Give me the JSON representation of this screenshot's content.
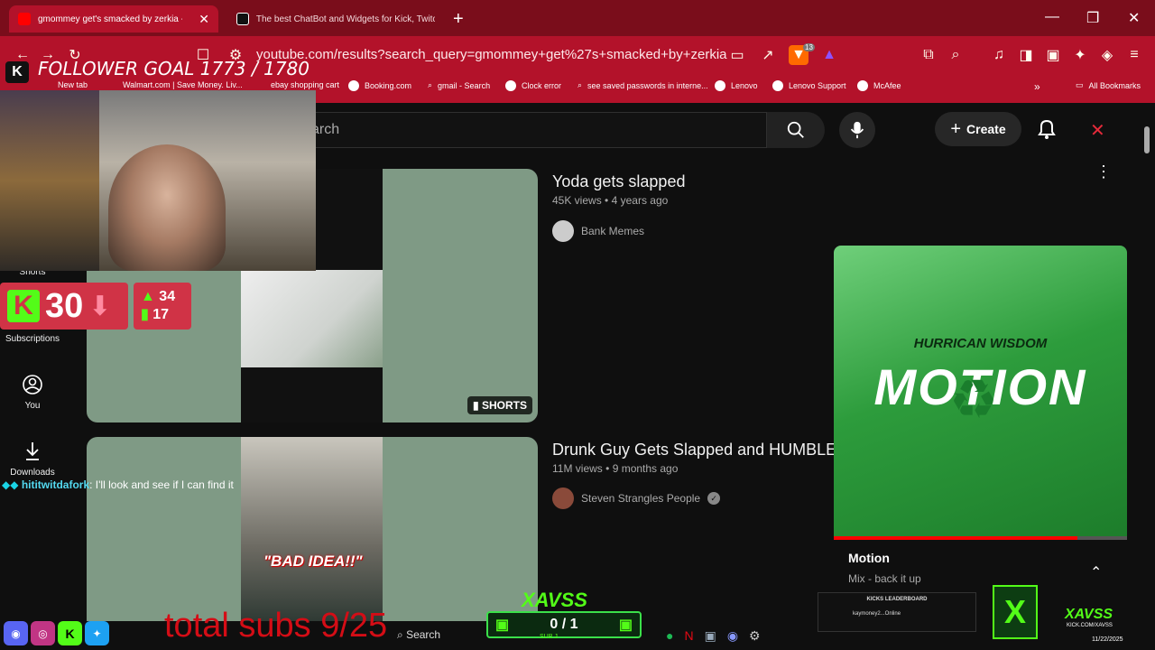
{
  "browser": {
    "tabs": [
      {
        "title": "gmommey get's smacked by zerkia - YouTube"
      },
      {
        "title": "The best ChatBot and Widgets for Kick, Twitch, YouTube"
      }
    ],
    "url": "youtube.com/results?search_query=gmommey+get%27s+smacked+by+zerkia",
    "bookmarks": [
      "New tab",
      "Walmart.com | Save Money. Liv...",
      "ebay shopping cart",
      "Booking.com",
      "gmail - Search",
      "Clock error",
      "see saved passwords in interne...",
      "Lenovo",
      "Lenovo Support",
      "McAfee"
    ],
    "all_bookmarks": "All Bookmarks",
    "extension_badge": "13"
  },
  "youtube": {
    "search_placeholder": "arch",
    "create_label": "Create",
    "sidebar": [
      {
        "label": "Shorts"
      },
      {
        "label": "Subscriptions"
      },
      {
        "label": "You"
      },
      {
        "label": "Downloads"
      }
    ],
    "results": [
      {
        "title": "Yoda gets slapped",
        "views": "45K views",
        "age": "4 years ago",
        "channel": "Bank Memes",
        "badge": "SHORTS",
        "dot": "•"
      },
      {
        "title": "Drunk Guy Gets Slapped and HUMBLED",
        "views": "11M views",
        "age": "9 months ago",
        "channel": "Steven Strangles People",
        "caption": "\"BAD IDEA!!\"",
        "dot": "•"
      }
    ],
    "miniplayer": {
      "title": "Motion",
      "subtitle": "Mix - back it up",
      "art_top": "HURRICAN WISDOM",
      "art_main": "MOTION",
      "progress": 0.83
    }
  },
  "overlay": {
    "follower_goal": "FOLLOWER GOAL 1773 / 1780",
    "kick_count": "30",
    "stat_up": "34",
    "stat_bar": "17",
    "chat_user": "hititwitdafork",
    "chat_message": ": I'll look and see if I can find it",
    "total_subs": "total subs 9/25",
    "sub_goal_logo": "XAVSS",
    "sub_goal_value": "0 / 1",
    "sub_goal_caption": "SUB J",
    "leaderboard_title": "KICKS LEADERBOARD",
    "leaderboard_row": "kaymoney2...Online",
    "brand": "XAVSS",
    "brand_sub": "KICK.COM/XAVSS",
    "taskbar_search": "Search",
    "date": "11/22/2025"
  },
  "colors": {
    "chrome": "#b3122a",
    "kick_green": "#53fc18",
    "accent_red": "#d03346"
  }
}
